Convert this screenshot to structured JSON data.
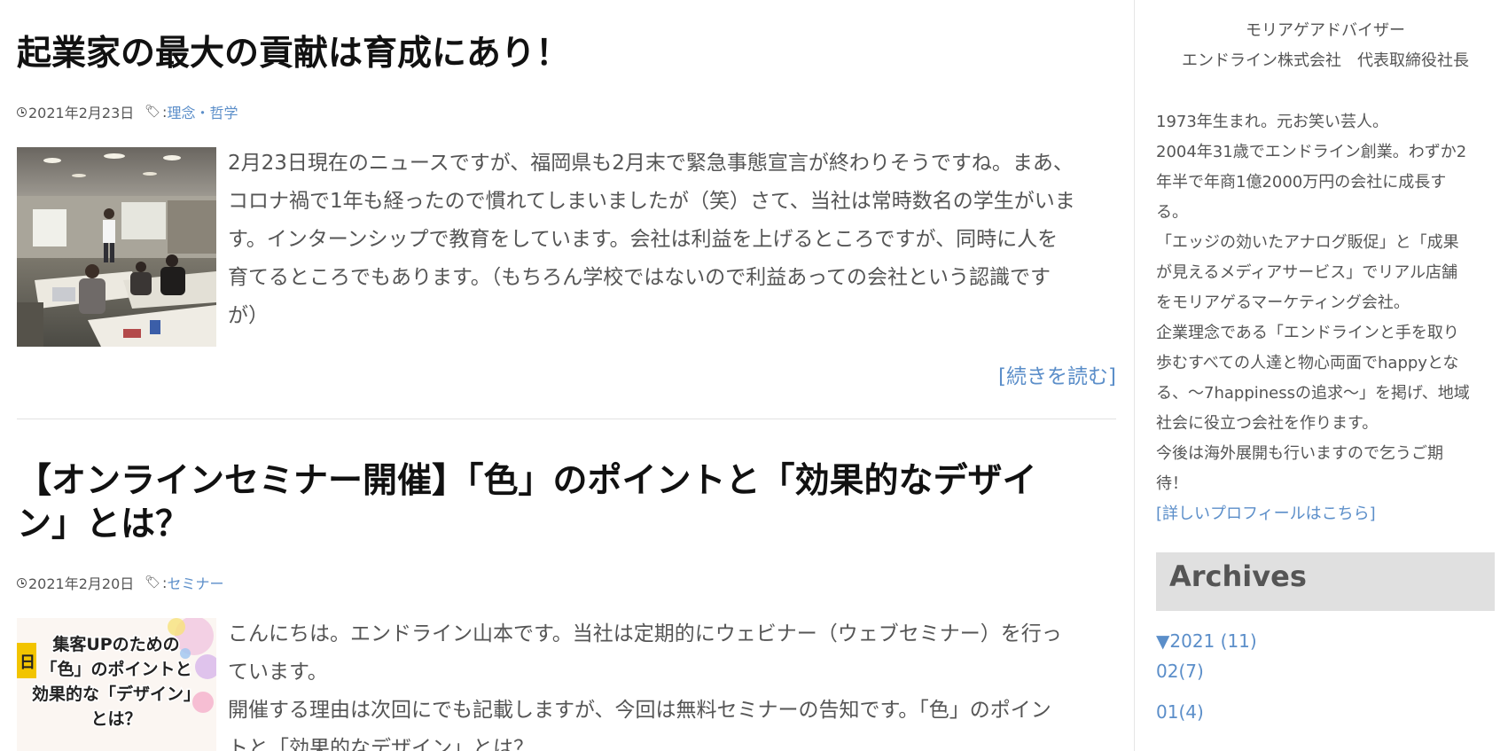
{
  "posts": [
    {
      "title": "起業家の最大の貢献は育成にあり！",
      "date": "2021年2月23日",
      "tag_prefix": ":",
      "category": "理念・哲学",
      "excerpt_lines": [
        "2月23日現在のニュースですが、福岡県も2月末で緊急事態宣言が終わりそうですね。まあ、",
        "コロナ禍で1年も経ったので慣れてしまいましたが（笑）さて、当社は常時数名の学生がいま",
        "す。インターンシップで教育をしています。会社は利益を上げるところですが、同時に人を",
        "育てるところでもあります。（もちろん学校ではないので利益あっての会社という認識です",
        "が）"
      ],
      "read_more": "[続きを読む]"
    },
    {
      "title_line1": "【オンラインセミナー開催】「色」のポイントと「効果的なデザイ",
      "title_line2": "ン」とは？",
      "date": "2021年2月20日",
      "tag_prefix": ":",
      "category": "セミナー",
      "excerpt_lines": [
        "こんにちは。エンドライン山本です。当社は定期的にウェビナー（ウェブセミナー）を行っ",
        "ています。",
        "開催する理由は次回にでも記載しますが、今回は無料セミナーの告知です。「色」のポイン",
        "トと「効果的なデザイン」とは？"
      ],
      "thumb_text": {
        "line1": "集客UPのための",
        "line2": "「色」のポイントと",
        "line3": "効果的な「デザイン」",
        "line4": "とは？",
        "side_mark": "日"
      }
    }
  ],
  "sidebar": {
    "role": "モリアゲアドバイザー",
    "company_title": "エンドライン株式会社　代表取締役社長",
    "bio_lines": [
      "1973年生まれ。元お笑い芸人。",
      "2004年31歳でエンドライン創業。わずか2",
      "年半で年商1億2000万円の会社に成長す",
      "る。",
      "「エッジの効いたアナログ販促」と「成果",
      "が見えるメディアサービス」でリアル店舗",
      "をモリアゲるマーケティング会社。",
      "企業理念である「エンドラインと手を取り",
      "歩むすべての人達と物心両面でhappyとな",
      "る、～7happinessの追求～」を掲げ、地域",
      "社会に役立つ会社を作ります。",
      "今後は海外展開も行いますので乞うご期",
      "待！"
    ],
    "profile_link": "[詳しいプロフィールはこちら]",
    "archives_title": "Archives",
    "archives": [
      {
        "label": "▼2021 (11)"
      },
      {
        "label": "02(7)"
      },
      {
        "label": "01(4)"
      }
    ]
  },
  "colors": {
    "link": "#5b8ec9",
    "title": "#111111",
    "text": "#555555",
    "archives_bg": "#e0e0e0"
  }
}
